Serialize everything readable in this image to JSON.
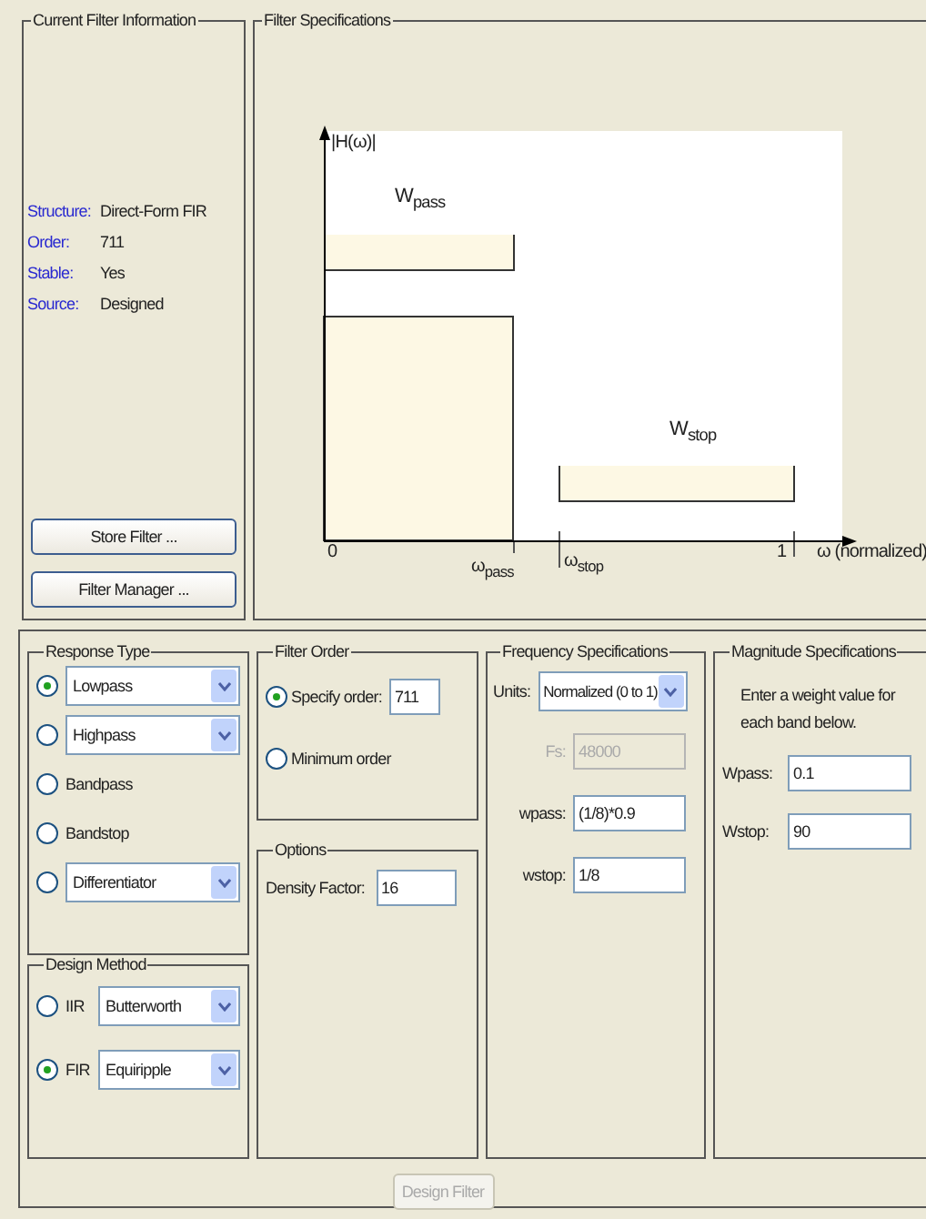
{
  "current_filter_information": {
    "title": "Current Filter Information",
    "fields": [
      {
        "label": "Structure:",
        "value": "Direct-Form FIR"
      },
      {
        "label": "Order:",
        "value": "711"
      },
      {
        "label": "Stable:",
        "value": "Yes"
      },
      {
        "label": "Source:",
        "value": "Designed"
      }
    ],
    "buttons": [
      "Store Filter ...",
      "Filter Manager ..."
    ]
  },
  "filter_specifications": {
    "title": "Filter Specifications",
    "diagram": {
      "y_label": "|H(ω)|",
      "pass_weight": "W$_{pass}$",
      "stop_weight": "W$_{stop}$",
      "x_start": "0",
      "pass_edge": "ω$_{pass}$",
      "stop_edge": "ω$_{stop}$",
      "x_end": "1",
      "x_label": "ω (normalized)"
    }
  },
  "response_type": {
    "title": "Response Type",
    "options": [
      {
        "kind": "dropdown",
        "label": "Lowpass",
        "selected": true
      },
      {
        "kind": "dropdown",
        "label": "Highpass",
        "selected": false
      },
      {
        "kind": "radio",
        "label": "Bandpass",
        "selected": false
      },
      {
        "kind": "radio",
        "label": "Bandstop",
        "selected": false
      },
      {
        "kind": "dropdown",
        "label": "Differentiator",
        "selected": false
      }
    ]
  },
  "design_method": {
    "title": "Design Method",
    "options": [
      {
        "label": "IIR",
        "value": "Butterworth",
        "selected": false
      },
      {
        "label": "FIR",
        "value": "Equiripple",
        "selected": true
      }
    ]
  },
  "filter_order": {
    "title": "Filter Order",
    "options": [
      {
        "label": "Specify order:",
        "value": "711",
        "selected": true
      },
      {
        "label": "Minimum order",
        "selected": false
      }
    ]
  },
  "options": {
    "title": "Options",
    "fields": [
      {
        "label": "Density Factor:",
        "value": "16"
      }
    ]
  },
  "frequency_specifications": {
    "title": "Frequency Specifications",
    "units": {
      "label": "Units:",
      "value": "Normalized (0 to 1)"
    },
    "fields": [
      {
        "label": "Fs:",
        "value": "48000",
        "disabled": true
      },
      {
        "label": "wpass:",
        "value": "(1/8)*0.9",
        "disabled": false
      },
      {
        "label": "wstop:",
        "value": "1/8",
        "disabled": false
      }
    ]
  },
  "magnitude_specifications": {
    "title": "Magnitude Specifications",
    "note": "Enter a weight value for each band below.",
    "fields": [
      {
        "label": "Wpass:",
        "value": "0.1"
      },
      {
        "label": "Wstop:",
        "value": "90"
      }
    ]
  },
  "design_button": {
    "label": "Design Filter",
    "disabled": true
  }
}
